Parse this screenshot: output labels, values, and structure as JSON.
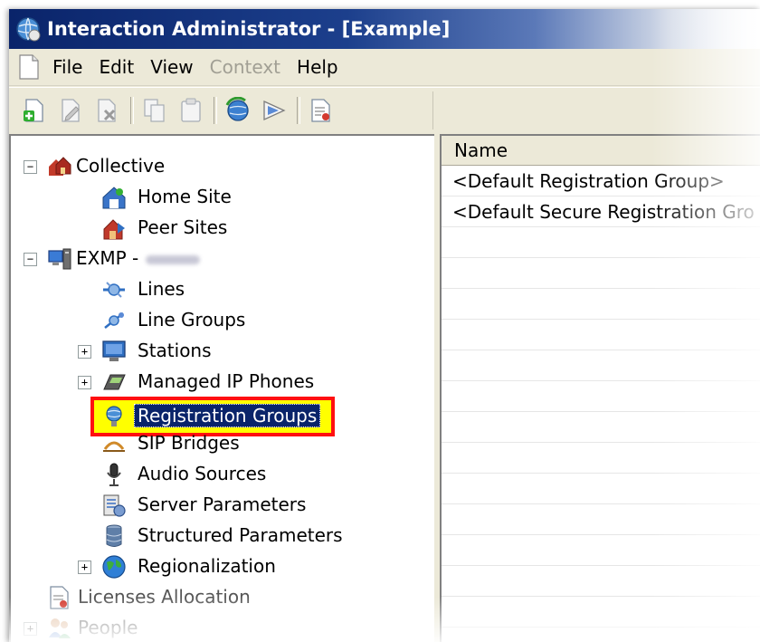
{
  "window": {
    "title": "Interaction Administrator - [Example]",
    "icons": [
      "app-globe-icon"
    ]
  },
  "menubar": {
    "items": [
      {
        "label": "File",
        "enabled": true
      },
      {
        "label": "Edit",
        "enabled": true
      },
      {
        "label": "View",
        "enabled": true
      },
      {
        "label": "Context",
        "enabled": false
      },
      {
        "label": "Help",
        "enabled": true
      }
    ]
  },
  "toolbar": {
    "buttons": [
      "new-icon",
      "edit-icon",
      "delete-icon",
      "copy-icon",
      "paste-icon",
      "globe-refresh-icon",
      "filter-icon",
      "report-icon"
    ]
  },
  "tree": {
    "collective": "Collective",
    "home_site": "Home Site",
    "peer_sites": "Peer Sites",
    "server": "EXMP -",
    "lines": "Lines",
    "line_groups": "Line Groups",
    "stations": "Stations",
    "managed_ip_phones": "Managed IP Phones",
    "registration_groups": "Registration Groups",
    "sip_bridges": "SIP Bridges",
    "audio_sources": "Audio Sources",
    "server_parameters": "Server Parameters",
    "structured_parameters": "Structured Parameters",
    "regionalization": "Regionalization",
    "licenses_allocation": "Licenses Allocation",
    "people": "People",
    "expander_plus": "+",
    "expander_minus": "−"
  },
  "list": {
    "column_name": "Name",
    "rows": [
      "<Default Registration Group>",
      "<Default Secure Registration Gro"
    ]
  },
  "colors": {
    "titlebar": "#0a246a",
    "highlight_border": "#ff1010",
    "highlight_fill": "#ffff00",
    "selection": "#0a246a"
  }
}
